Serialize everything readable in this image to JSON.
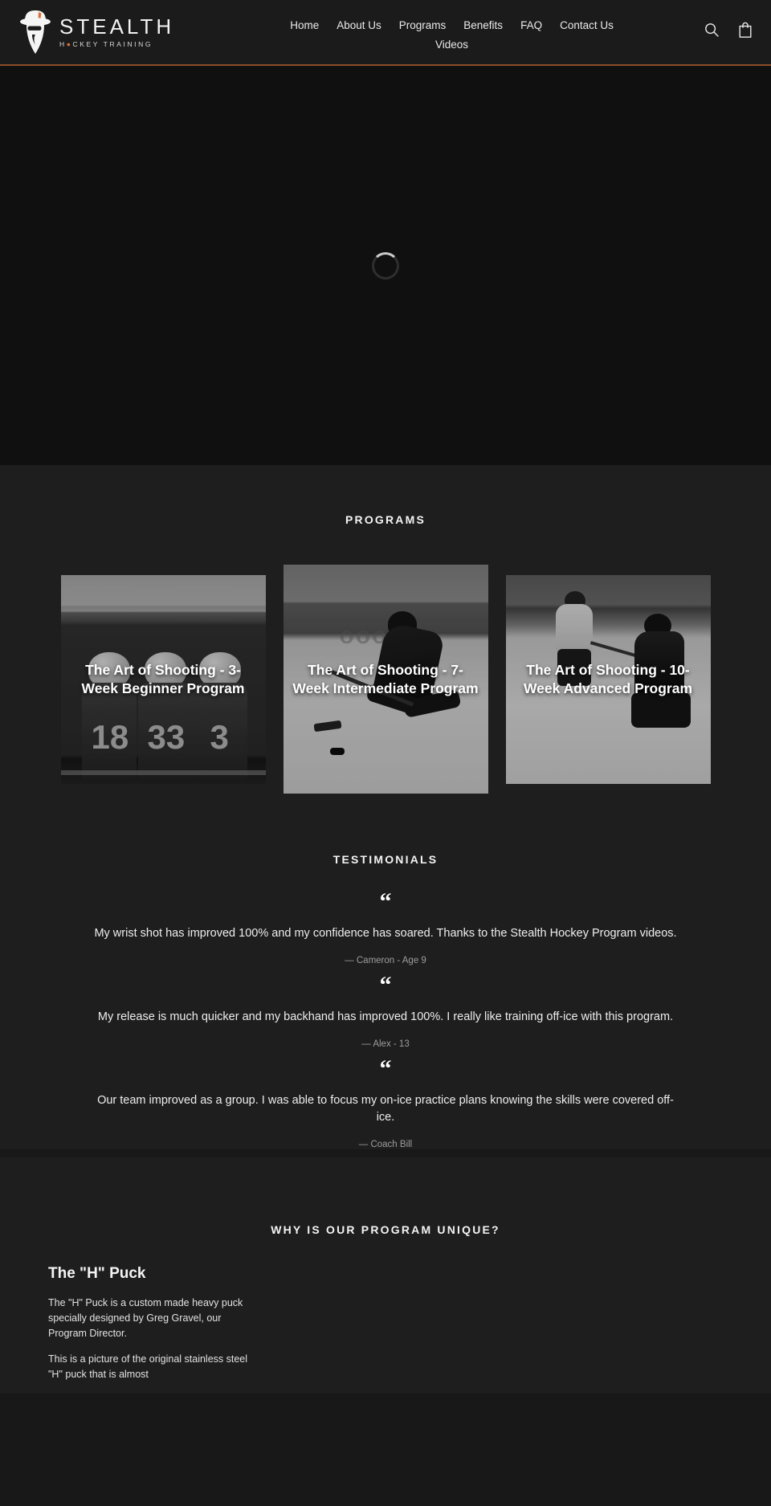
{
  "header": {
    "brand": {
      "word": "STEALTH",
      "sub_pre": "H",
      "sub_dot": "⬤",
      "sub_post": "CKEY TRAINING",
      "accent_color": "#e0703a",
      "logo_icon": "detective-hat-figure-icon"
    },
    "nav": [
      {
        "label": "Home"
      },
      {
        "label": "About Us"
      },
      {
        "label": "Programs"
      },
      {
        "label": "Benefits"
      },
      {
        "label": "FAQ"
      },
      {
        "label": "Contact Us"
      },
      {
        "label": "Videos"
      }
    ],
    "actions": {
      "search_icon": "search-icon",
      "cart_icon": "shopping-bag-icon"
    },
    "border_color": "#8a4e28",
    "background": "#1b1b1b"
  },
  "hero": {
    "state": "loading",
    "spinner_icon": "loading-spinner-icon",
    "background": "#101010"
  },
  "programs": {
    "title": "PROGRAMS",
    "cards": [
      {
        "title": "The Art of Shooting - 3-Week Beginner Program",
        "photo": "hockey-players-on-bench-grayscale",
        "jersey_numbers": [
          "18",
          "33",
          "3"
        ]
      },
      {
        "title": "The Art of Shooting - 7-Week Intermediate Program",
        "photo": "skater-with-puck-grayscale"
      },
      {
        "title": "The Art of Shooting - 10-Week Advanced Program",
        "photo": "two-skaters-on-ice-grayscale"
      }
    ]
  },
  "testimonials": {
    "title": "TESTIMONIALS",
    "quote_glyph": "“",
    "items": [
      {
        "text": "My wrist shot has improved 100% and my confidence has soared. Thanks to the Stealth Hockey Program videos.",
        "author": "— Cameron - Age 9"
      },
      {
        "text": "My release is much quicker and my backhand has improved 100%. I really like training off-ice with this program.",
        "author": "— Alex - 13"
      },
      {
        "text": "Our team improved as a group. I was able to focus my on-ice practice plans knowing the skills were covered off-ice.",
        "author": "— Coach Bill"
      }
    ]
  },
  "unique": {
    "title": "WHY IS OUR PROGRAM UNIQUE?",
    "heading": "The \"H\" Puck",
    "paragraph_1": "The \"H\" Puck is a custom made heavy puck specially designed by Greg Gravel, our Program Director.",
    "paragraph_2": "This is a picture of the original stainless steel  \"H\" puck that is almost"
  }
}
